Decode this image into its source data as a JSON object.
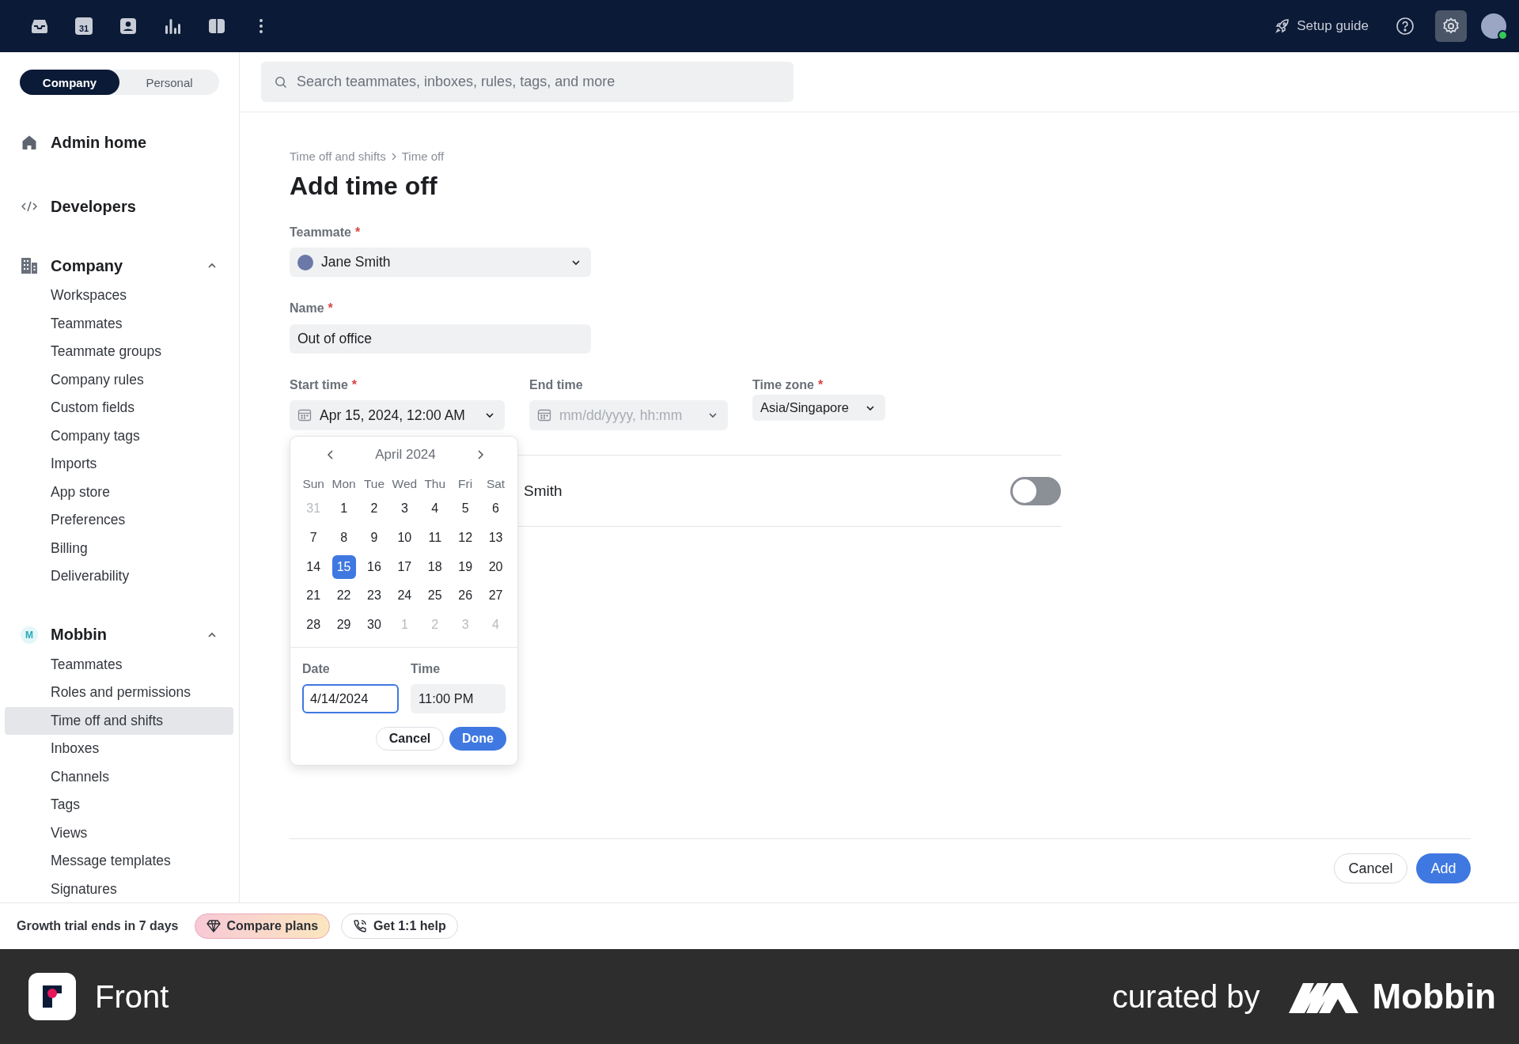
{
  "topbar": {
    "nav": [
      {
        "kind": "inbox"
      },
      {
        "kind": "calendar",
        "text": "31"
      },
      {
        "kind": "contacts"
      },
      {
        "kind": "analytics"
      },
      {
        "kind": "split"
      },
      {
        "kind": "more"
      }
    ],
    "setup_guide": "Setup guide",
    "settings": {
      "selected": true
    }
  },
  "scope_tabs": [
    {
      "label": "Company",
      "selected": true
    },
    {
      "label": "Personal",
      "selected": false
    }
  ],
  "search": {
    "placeholder": "Search teammates, inboxes, rules, tags, and more"
  },
  "sidebar": {
    "links": [
      {
        "label": "Admin home",
        "kind": "home"
      },
      {
        "label": "Developers",
        "kind": "code"
      }
    ],
    "sections": [
      {
        "title": "Company",
        "kind": "building",
        "expanded": true,
        "items": [
          {
            "label": "Workspaces",
            "selected": false
          },
          {
            "label": "Teammates",
            "selected": false
          },
          {
            "label": "Teammate groups",
            "selected": false
          },
          {
            "label": "Company rules",
            "selected": false
          },
          {
            "label": "Custom fields",
            "selected": false
          },
          {
            "label": "Company tags",
            "selected": false
          },
          {
            "label": "Imports",
            "selected": false
          },
          {
            "label": "App store",
            "selected": false
          },
          {
            "label": "Preferences",
            "selected": false
          },
          {
            "label": "Billing",
            "selected": false
          },
          {
            "label": "Deliverability",
            "selected": false
          }
        ]
      },
      {
        "title": "Mobbin",
        "kind": "badge",
        "badge": "M",
        "expanded": true,
        "items": [
          {
            "label": "Teammates",
            "selected": false
          },
          {
            "label": "Roles and permissions",
            "selected": false
          },
          {
            "label": "Time off and shifts",
            "selected": true
          },
          {
            "label": "Inboxes",
            "selected": false
          },
          {
            "label": "Channels",
            "selected": false
          },
          {
            "label": "Tags",
            "selected": false
          },
          {
            "label": "Views",
            "selected": false
          },
          {
            "label": "Message templates",
            "selected": false
          },
          {
            "label": "Signatures",
            "selected": false
          }
        ]
      }
    ]
  },
  "breadcrumb": [
    "Time off and shifts",
    "Time off"
  ],
  "title": "Add time off",
  "form": {
    "teammate": {
      "label": "Teammate",
      "required_mark": "*",
      "value": "Jane Smith"
    },
    "name": {
      "label": "Name",
      "required_mark": "*",
      "value": "Out of office"
    },
    "start_time": {
      "label": "Start time",
      "required_mark": "*",
      "value": "Apr 15, 2024, 12:00 AM"
    },
    "end_time": {
      "label": "End time",
      "placeholder": "mm/dd/yyyy, hh:mm"
    },
    "time_zone": {
      "label": "Time zone",
      "required_mark": "*",
      "value": "Asia/Singapore"
    },
    "option_row": {
      "label": "Smith",
      "on": false
    }
  },
  "date_picker": {
    "month": "April 2024",
    "weekdays": [
      "Sun",
      "Mon",
      "Tue",
      "Wed",
      "Thu",
      "Fri",
      "Sat"
    ],
    "days": [
      {
        "label": "31",
        "outside": true,
        "selected": false
      },
      {
        "label": "1",
        "outside": false,
        "selected": false
      },
      {
        "label": "2",
        "outside": false,
        "selected": false
      },
      {
        "label": "3",
        "outside": false,
        "selected": false
      },
      {
        "label": "4",
        "outside": false,
        "selected": false
      },
      {
        "label": "5",
        "outside": false,
        "selected": false
      },
      {
        "label": "6",
        "outside": false,
        "selected": false
      },
      {
        "label": "7",
        "outside": false,
        "selected": false
      },
      {
        "label": "8",
        "outside": false,
        "selected": false
      },
      {
        "label": "9",
        "outside": false,
        "selected": false
      },
      {
        "label": "10",
        "outside": false,
        "selected": false
      },
      {
        "label": "11",
        "outside": false,
        "selected": false
      },
      {
        "label": "12",
        "outside": false,
        "selected": false
      },
      {
        "label": "13",
        "outside": false,
        "selected": false
      },
      {
        "label": "14",
        "outside": false,
        "selected": false
      },
      {
        "label": "15",
        "outside": false,
        "selected": true
      },
      {
        "label": "16",
        "outside": false,
        "selected": false
      },
      {
        "label": "17",
        "outside": false,
        "selected": false
      },
      {
        "label": "18",
        "outside": false,
        "selected": false
      },
      {
        "label": "19",
        "outside": false,
        "selected": false
      },
      {
        "label": "20",
        "outside": false,
        "selected": false
      },
      {
        "label": "21",
        "outside": false,
        "selected": false
      },
      {
        "label": "22",
        "outside": false,
        "selected": false
      },
      {
        "label": "23",
        "outside": false,
        "selected": false
      },
      {
        "label": "24",
        "outside": false,
        "selected": false
      },
      {
        "label": "25",
        "outside": false,
        "selected": false
      },
      {
        "label": "26",
        "outside": false,
        "selected": false
      },
      {
        "label": "27",
        "outside": false,
        "selected": false
      },
      {
        "label": "28",
        "outside": false,
        "selected": false
      },
      {
        "label": "29",
        "outside": false,
        "selected": false
      },
      {
        "label": "30",
        "outside": false,
        "selected": false
      },
      {
        "label": "1",
        "outside": true,
        "selected": false
      },
      {
        "label": "2",
        "outside": true,
        "selected": false
      },
      {
        "label": "3",
        "outside": true,
        "selected": false
      },
      {
        "label": "4",
        "outside": true,
        "selected": false
      }
    ],
    "date": {
      "label": "Date",
      "value": "4/14/2024",
      "focused": true
    },
    "time": {
      "label": "Time",
      "value": "11:00 PM"
    },
    "cancel": "Cancel",
    "done": "Done"
  },
  "actions": {
    "cancel": "Cancel",
    "add": "Add"
  },
  "trial_bar": {
    "text": "Growth trial ends in 7 days",
    "compare": "Compare plans",
    "help": "Get 1:1 help"
  },
  "footer": {
    "app": "Front",
    "curated_by": "curated by",
    "brand": "Mobbin"
  }
}
